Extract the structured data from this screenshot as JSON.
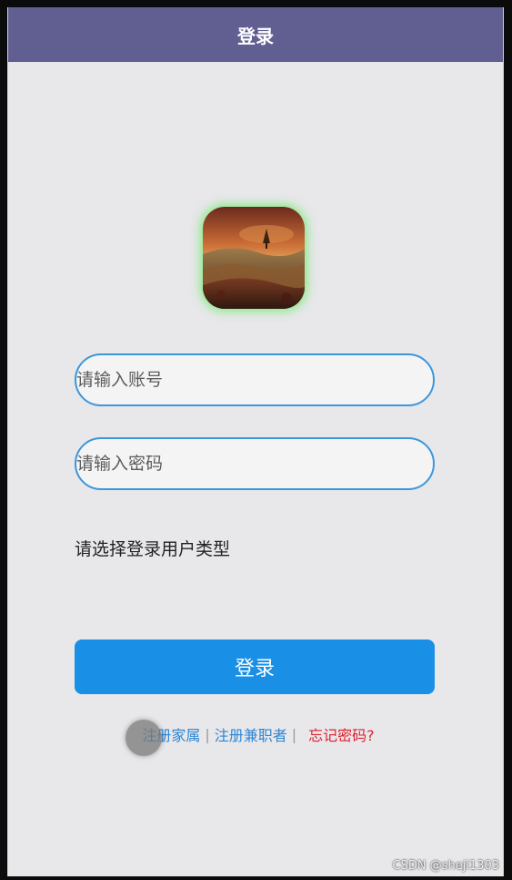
{
  "header": {
    "title": "登录"
  },
  "logo": {
    "icon": "landscape-image",
    "glow_color": "#7feb7f"
  },
  "form": {
    "account_placeholder": "请输入账号",
    "account_value": "",
    "password_placeholder": "请输入密码",
    "password_value": "",
    "user_type_label": "请选择登录用户类型",
    "login_button": "登录"
  },
  "links": {
    "register_employer": "注册家属",
    "separator": "|",
    "register_parttime": "注册兼职者",
    "forgot_password": "忘记密码?"
  },
  "watermark": "CSDN @sheji1303",
  "colors": {
    "header_bg": "#615f91",
    "page_bg": "#e8e7ea",
    "accent_blue": "#198fe6",
    "input_border": "#3b97dc",
    "link_blue": "#2e86d4",
    "link_red": "#e0212d"
  }
}
